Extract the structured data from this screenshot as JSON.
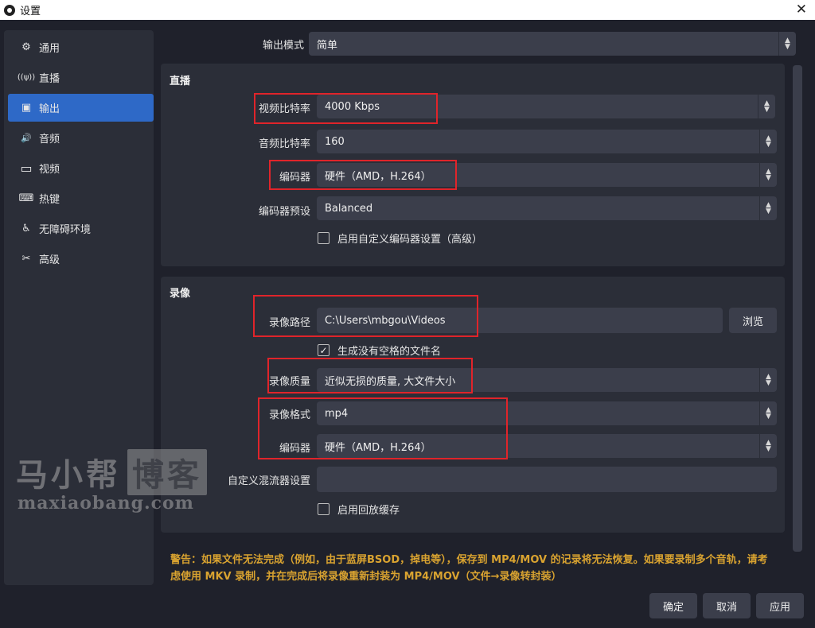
{
  "window": {
    "title": "设置",
    "close_glyph": "✕"
  },
  "sidebar": {
    "items": [
      {
        "label": "通用",
        "icon": "gear-icon",
        "glyph": "⚙"
      },
      {
        "label": "直播",
        "icon": "broadcast-icon",
        "glyph": "((ψ))"
      },
      {
        "label": "输出",
        "icon": "output-icon",
        "glyph": "▣"
      },
      {
        "label": "音频",
        "icon": "speaker-icon",
        "glyph": "🔊"
      },
      {
        "label": "视频",
        "icon": "monitor-icon",
        "glyph": "▭"
      },
      {
        "label": "热键",
        "icon": "keyboard-icon",
        "glyph": "⌨"
      },
      {
        "label": "无障碍环境",
        "icon": "accessibility-icon",
        "glyph": "♿"
      },
      {
        "label": "高级",
        "icon": "wrench-icon",
        "glyph": "✂"
      }
    ],
    "active_index": 2
  },
  "output_mode": {
    "label": "输出模式",
    "value": "简单"
  },
  "streaming": {
    "title": "直播",
    "video_bitrate": {
      "label": "视频比特率",
      "value": "4000 Kbps"
    },
    "audio_bitrate": {
      "label": "音频比特率",
      "value": "160"
    },
    "encoder": {
      "label": "编码器",
      "value": "硬件（AMD，H.264）"
    },
    "encoder_preset": {
      "label": "编码器预设",
      "value": "Balanced"
    },
    "custom_encoder": {
      "label": "启用自定义编码器设置（高级）",
      "checked": false
    }
  },
  "recording": {
    "title": "录像",
    "path": {
      "label": "录像路径",
      "value": "C:\\Users\\mbgou\\Videos"
    },
    "browse_label": "浏览",
    "no_space_filename": {
      "label": "生成没有空格的文件名",
      "checked": true
    },
    "quality": {
      "label": "录像质量",
      "value": "近似无损的质量, 大文件大小"
    },
    "format": {
      "label": "录像格式",
      "value": "mp4"
    },
    "encoder": {
      "label": "编码器",
      "value": "硬件（AMD，H.264）"
    },
    "custom_muxer": {
      "label": "自定义混流器设置",
      "value": ""
    },
    "replay_buffer": {
      "label": "启用回放缓存",
      "checked": false
    }
  },
  "warning": "警告：如果文件无法完成（例如，由于蓝屏BSOD，掉电等），保存到 MP4/MOV 的记录将无法恢复。如果要录制多个音轨，请考虑使用 MKV 录制，并在完成后将录像重新封装为 MP4/MOV（文件→录像转封装）",
  "buttons": {
    "ok": "确定",
    "cancel": "取消",
    "apply": "应用"
  },
  "watermark": {
    "cn_main": "马小帮",
    "cn_box": "博客",
    "en": "maxiaobang.com"
  },
  "colors": {
    "accent": "#2e69c7",
    "warning": "#d9a330",
    "highlight": "#e0242a"
  }
}
